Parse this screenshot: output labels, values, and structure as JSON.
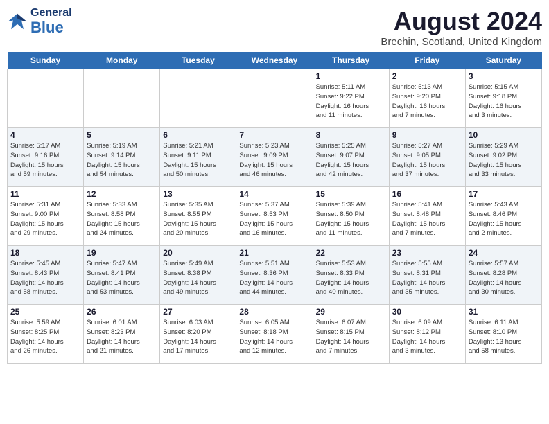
{
  "header": {
    "logo_general": "General",
    "logo_blue": "Blue",
    "title": "August 2024",
    "subtitle": "Brechin, Scotland, United Kingdom"
  },
  "days_of_week": [
    "Sunday",
    "Monday",
    "Tuesday",
    "Wednesday",
    "Thursday",
    "Friday",
    "Saturday"
  ],
  "weeks": [
    [
      {
        "day": "",
        "content": ""
      },
      {
        "day": "",
        "content": ""
      },
      {
        "day": "",
        "content": ""
      },
      {
        "day": "",
        "content": ""
      },
      {
        "day": "1",
        "content": "Sunrise: 5:11 AM\nSunset: 9:22 PM\nDaylight: 16 hours\nand 11 minutes."
      },
      {
        "day": "2",
        "content": "Sunrise: 5:13 AM\nSunset: 9:20 PM\nDaylight: 16 hours\nand 7 minutes."
      },
      {
        "day": "3",
        "content": "Sunrise: 5:15 AM\nSunset: 9:18 PM\nDaylight: 16 hours\nand 3 minutes."
      }
    ],
    [
      {
        "day": "4",
        "content": "Sunrise: 5:17 AM\nSunset: 9:16 PM\nDaylight: 15 hours\nand 59 minutes."
      },
      {
        "day": "5",
        "content": "Sunrise: 5:19 AM\nSunset: 9:14 PM\nDaylight: 15 hours\nand 54 minutes."
      },
      {
        "day": "6",
        "content": "Sunrise: 5:21 AM\nSunset: 9:11 PM\nDaylight: 15 hours\nand 50 minutes."
      },
      {
        "day": "7",
        "content": "Sunrise: 5:23 AM\nSunset: 9:09 PM\nDaylight: 15 hours\nand 46 minutes."
      },
      {
        "day": "8",
        "content": "Sunrise: 5:25 AM\nSunset: 9:07 PM\nDaylight: 15 hours\nand 42 minutes."
      },
      {
        "day": "9",
        "content": "Sunrise: 5:27 AM\nSunset: 9:05 PM\nDaylight: 15 hours\nand 37 minutes."
      },
      {
        "day": "10",
        "content": "Sunrise: 5:29 AM\nSunset: 9:02 PM\nDaylight: 15 hours\nand 33 minutes."
      }
    ],
    [
      {
        "day": "11",
        "content": "Sunrise: 5:31 AM\nSunset: 9:00 PM\nDaylight: 15 hours\nand 29 minutes."
      },
      {
        "day": "12",
        "content": "Sunrise: 5:33 AM\nSunset: 8:58 PM\nDaylight: 15 hours\nand 24 minutes."
      },
      {
        "day": "13",
        "content": "Sunrise: 5:35 AM\nSunset: 8:55 PM\nDaylight: 15 hours\nand 20 minutes."
      },
      {
        "day": "14",
        "content": "Sunrise: 5:37 AM\nSunset: 8:53 PM\nDaylight: 15 hours\nand 16 minutes."
      },
      {
        "day": "15",
        "content": "Sunrise: 5:39 AM\nSunset: 8:50 PM\nDaylight: 15 hours\nand 11 minutes."
      },
      {
        "day": "16",
        "content": "Sunrise: 5:41 AM\nSunset: 8:48 PM\nDaylight: 15 hours\nand 7 minutes."
      },
      {
        "day": "17",
        "content": "Sunrise: 5:43 AM\nSunset: 8:46 PM\nDaylight: 15 hours\nand 2 minutes."
      }
    ],
    [
      {
        "day": "18",
        "content": "Sunrise: 5:45 AM\nSunset: 8:43 PM\nDaylight: 14 hours\nand 58 minutes."
      },
      {
        "day": "19",
        "content": "Sunrise: 5:47 AM\nSunset: 8:41 PM\nDaylight: 14 hours\nand 53 minutes."
      },
      {
        "day": "20",
        "content": "Sunrise: 5:49 AM\nSunset: 8:38 PM\nDaylight: 14 hours\nand 49 minutes."
      },
      {
        "day": "21",
        "content": "Sunrise: 5:51 AM\nSunset: 8:36 PM\nDaylight: 14 hours\nand 44 minutes."
      },
      {
        "day": "22",
        "content": "Sunrise: 5:53 AM\nSunset: 8:33 PM\nDaylight: 14 hours\nand 40 minutes."
      },
      {
        "day": "23",
        "content": "Sunrise: 5:55 AM\nSunset: 8:31 PM\nDaylight: 14 hours\nand 35 minutes."
      },
      {
        "day": "24",
        "content": "Sunrise: 5:57 AM\nSunset: 8:28 PM\nDaylight: 14 hours\nand 30 minutes."
      }
    ],
    [
      {
        "day": "25",
        "content": "Sunrise: 5:59 AM\nSunset: 8:25 PM\nDaylight: 14 hours\nand 26 minutes."
      },
      {
        "day": "26",
        "content": "Sunrise: 6:01 AM\nSunset: 8:23 PM\nDaylight: 14 hours\nand 21 minutes."
      },
      {
        "day": "27",
        "content": "Sunrise: 6:03 AM\nSunset: 8:20 PM\nDaylight: 14 hours\nand 17 minutes."
      },
      {
        "day": "28",
        "content": "Sunrise: 6:05 AM\nSunset: 8:18 PM\nDaylight: 14 hours\nand 12 minutes."
      },
      {
        "day": "29",
        "content": "Sunrise: 6:07 AM\nSunset: 8:15 PM\nDaylight: 14 hours\nand 7 minutes."
      },
      {
        "day": "30",
        "content": "Sunrise: 6:09 AM\nSunset: 8:12 PM\nDaylight: 14 hours\nand 3 minutes."
      },
      {
        "day": "31",
        "content": "Sunrise: 6:11 AM\nSunset: 8:10 PM\nDaylight: 13 hours\nand 58 minutes."
      }
    ]
  ]
}
